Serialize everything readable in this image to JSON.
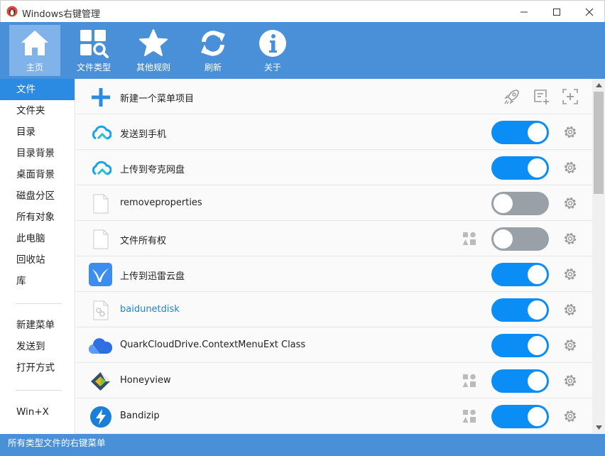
{
  "window": {
    "title": "Windows右键管理"
  },
  "toolbar": {
    "items": [
      {
        "label": "主页",
        "icon": "home-icon",
        "active": true
      },
      {
        "label": "文件类型",
        "icon": "file-types-icon",
        "active": false
      },
      {
        "label": "其他规则",
        "icon": "star-icon",
        "active": false
      },
      {
        "label": "刷新",
        "icon": "refresh-icon",
        "active": false
      },
      {
        "label": "关于",
        "icon": "info-icon",
        "active": false
      }
    ]
  },
  "sidebar": {
    "groups": [
      [
        "文件",
        "文件夹",
        "目录",
        "目录背景",
        "桌面背景",
        "磁盘分区",
        "所有对象",
        "此电脑",
        "回收站",
        "库"
      ],
      [
        "新建菜单",
        "发送到",
        "打开方式"
      ],
      [
        "Win+X"
      ]
    ],
    "active": "文件"
  },
  "list": {
    "new_item_label": "新建一个菜单项目",
    "rows": [
      {
        "label": "发送到手机",
        "icon": "cloud-icon",
        "enabled": true,
        "extra": false,
        "link": false
      },
      {
        "label": "上传到夸克网盘",
        "icon": "cloud-icon",
        "enabled": true,
        "extra": false,
        "link": false
      },
      {
        "label": "removeproperties",
        "icon": "blank-file-icon",
        "enabled": false,
        "extra": false,
        "link": false
      },
      {
        "label": "文件所有权",
        "icon": "blank-file-icon",
        "enabled": false,
        "extra": true,
        "link": false
      },
      {
        "label": "上传到迅雷云盘",
        "icon": "thunder-bird-icon",
        "enabled": true,
        "extra": false,
        "link": false
      },
      {
        "label": "baidunetdisk",
        "icon": "gear-file-icon",
        "enabled": true,
        "extra": false,
        "link": true
      },
      {
        "label": "QuarkCloudDrive.ContextMenuExt Class",
        "icon": "quark-cloud-icon",
        "enabled": true,
        "extra": false,
        "link": false
      },
      {
        "label": "Honeyview",
        "icon": "honeyview-icon",
        "enabled": true,
        "extra": true,
        "link": false
      },
      {
        "label": "Bandizip",
        "icon": "bandizip-icon",
        "enabled": true,
        "extra": true,
        "link": false
      }
    ]
  },
  "status": {
    "text": "所有类型文件的右键菜单"
  },
  "colors": {
    "accent": "#4a90d9",
    "toggle_on": "#0a8ef5",
    "toggle_off": "#9aa0a8",
    "active_item": "#2b8ae2"
  }
}
